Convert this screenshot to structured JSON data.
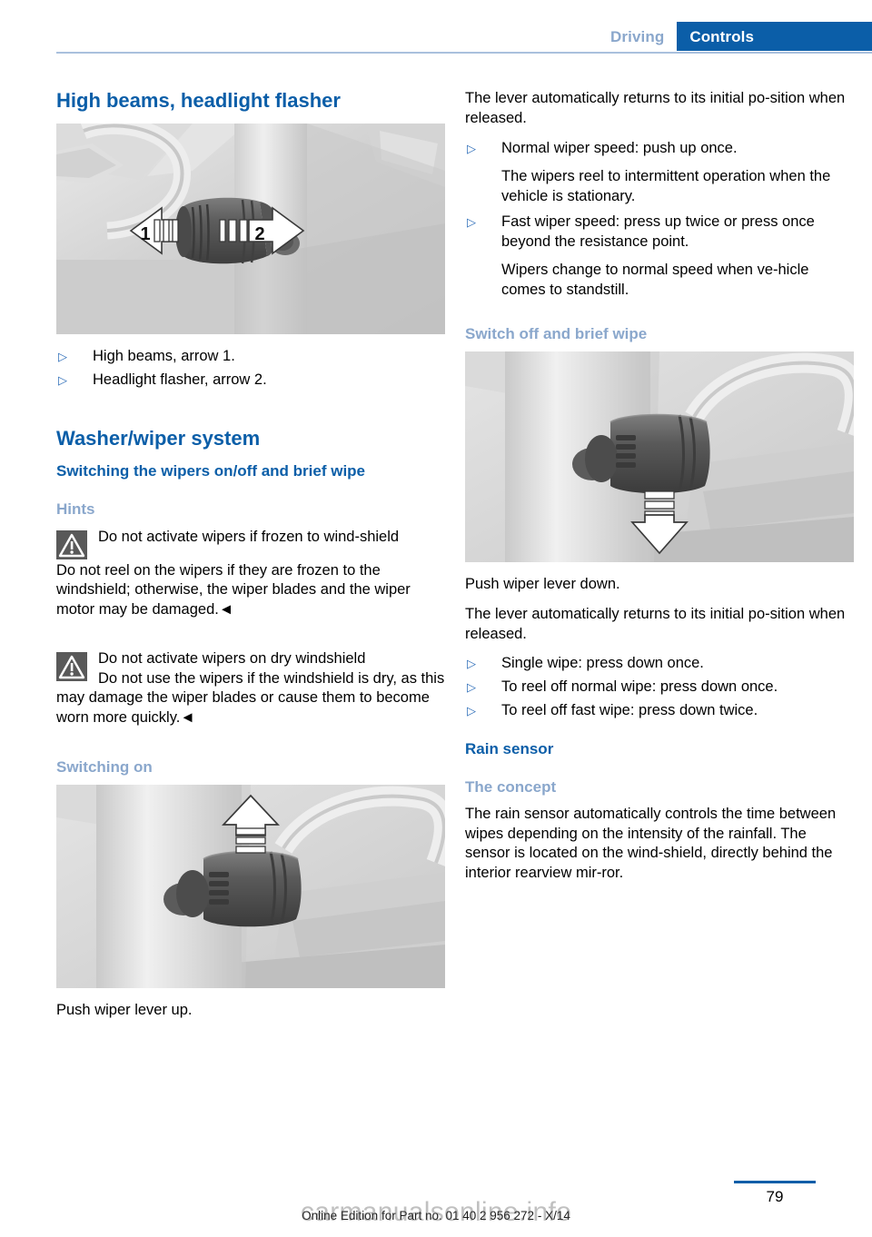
{
  "header": {
    "tab_inactive": "Driving",
    "tab_active": "Controls",
    "accent_blue": "#0b5ea8",
    "light_blue": "#8aa7cc"
  },
  "left_column": {
    "heading_high_beams": "High beams, headlight flasher",
    "figure_stalk_alt": "Steering column stalk with arrow 1 pointing left and arrow 2 pointing right",
    "bullets_high_beams": [
      "High beams, arrow 1.",
      "Headlight flasher, arrow 2."
    ],
    "heading_washer_wiper": "Washer/wiper system",
    "heading_switching_wipers": "Switching the wipers on/off and brief wipe",
    "heading_hints": "Hints",
    "warning_frozen": {
      "icon": "warning-triangle-icon",
      "title": "Do not activate wipers if frozen to wind‑shield",
      "body": "Do not reel on the wipers if they are frozen to the windshield; otherwise, the wiper blades and the wiper motor may be damaged.◄"
    },
    "warning_dry": {
      "icon": "warning-triangle-icon",
      "title": "Do not activate wipers on dry windshield",
      "body": "Do not use the wipers if the windshield is dry, as this may damage the wiper blades or cause them to become worn more quickly.◄"
    },
    "heading_switching_on": "Switching on",
    "figure_lever_up_alt": "Wiper lever with white arrow pointing up",
    "caption_push_up": "Push wiper lever up."
  },
  "right_column": {
    "para_lever_returns": "The lever automatically returns to its initial po‑sition when released.",
    "bullets_wiper_speed": [
      "Normal wiper speed: push up once.",
      "Fast wiper speed: press up twice or press once beyond the resistance point."
    ],
    "sub_normal_speed": "The wipers reel to intermittent operation when the vehicle is stationary.",
    "sub_fast_speed": "Wipers change to normal speed when ve‑hicle comes to standstill.",
    "heading_switch_off": "Switch off and brief wipe",
    "figure_lever_down_alt": "Wiper lever with white arrow pointing down",
    "caption_push_down": "Push wiper lever down.",
    "para_lever_returns_2": "The lever automatically returns to its initial po‑sition when released.",
    "bullets_switch_off": [
      "Single wipe: press down once.",
      "To reel off normal wipe: press down once.",
      "To reel off fast wipe: press down twice."
    ],
    "heading_rain_sensor": "Rain sensor",
    "heading_the_concept": "The concept",
    "para_rain_sensor": "The rain sensor automatically controls the time between wipes depending on the intensity of the rainfall. The sensor is located on the wind‑shield, directly behind the interior rearview mir‑ror."
  },
  "figure_labels": {
    "arrow_1": "1",
    "arrow_2": "2"
  },
  "footer": {
    "note": "Online Edition for Part no. 01 40 2 956 272 - X/14",
    "page_number": "79",
    "watermark": "carmanualsonline.info"
  },
  "bullet_marker": "▷"
}
